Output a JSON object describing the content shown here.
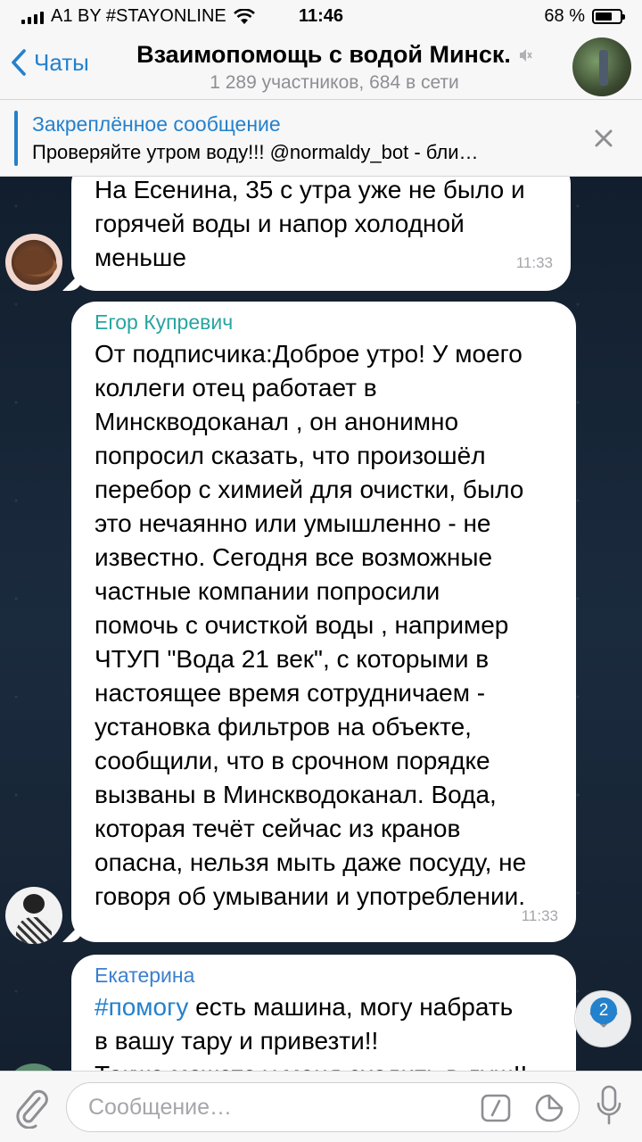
{
  "status": {
    "carrier": "A1 BY #STAYONLINE",
    "time": "11:46",
    "battery": "68 %",
    "battery_level": 0.68
  },
  "nav": {
    "back_label": "Чаты",
    "title": "Взаимопомощь с водой Минск.",
    "subtitle": "1 289 участников, 684 в сети"
  },
  "pinned": {
    "title": "Закреплённое сообщение",
    "text": "Проверяйте утром воду!!!  @normaldy_bot - бли…"
  },
  "messages": [
    {
      "author": "",
      "lines": [
        "На Есенина, 35 с утра уже не было и",
        "горячей воды и напор холодной",
        "меньше"
      ],
      "time": "11:33"
    },
    {
      "author": "Егор Купревич",
      "author_color": "#27a5a0",
      "lines": [
        "От подписчика:Доброе утро! У моего",
        "коллеги отец работает в",
        "Минскводоканал , он анонимно",
        "попросил сказать, что произошёл",
        "перебор с химией для очистки, было",
        "это нечаянно или умышленно - не",
        "известно. Сегодня все возможные",
        "частные компании попросили",
        "помочь с очисткой воды , например",
        "ЧТУП \"Вода 21 век\", с которыми в",
        "настоящее время сотрудничаем -",
        "установка фильтров на объекте,",
        "сообщили, что в срочном порядке",
        "вызваны в Минскводоканал. Вода,",
        "которая течёт сейчас из кранов",
        "опасна, нельзя мыть даже посуду, не",
        "говоря об умывании и употреблении."
      ],
      "time": "11:33"
    },
    {
      "author": "Екатерина",
      "author_color": "#3a7fd0",
      "hashtag": "#помогу",
      "first_line_rest": " есть машина, могу набрать",
      "lines": [
        "в вашу тару и привезти!!",
        "Также можете у меня сходить в душ!!"
      ]
    }
  ],
  "scroll_badge": "2",
  "composer": {
    "placeholder": "Сообщение…"
  },
  "icons": {
    "back": "chevron-left-icon",
    "mute": "speaker-mute-icon",
    "close": "close-icon",
    "attach": "paperclip-icon",
    "commands": "slash-command-icon",
    "sticker": "sticker-icon",
    "mic": "microphone-icon",
    "scroll": "chevron-down-icon"
  }
}
